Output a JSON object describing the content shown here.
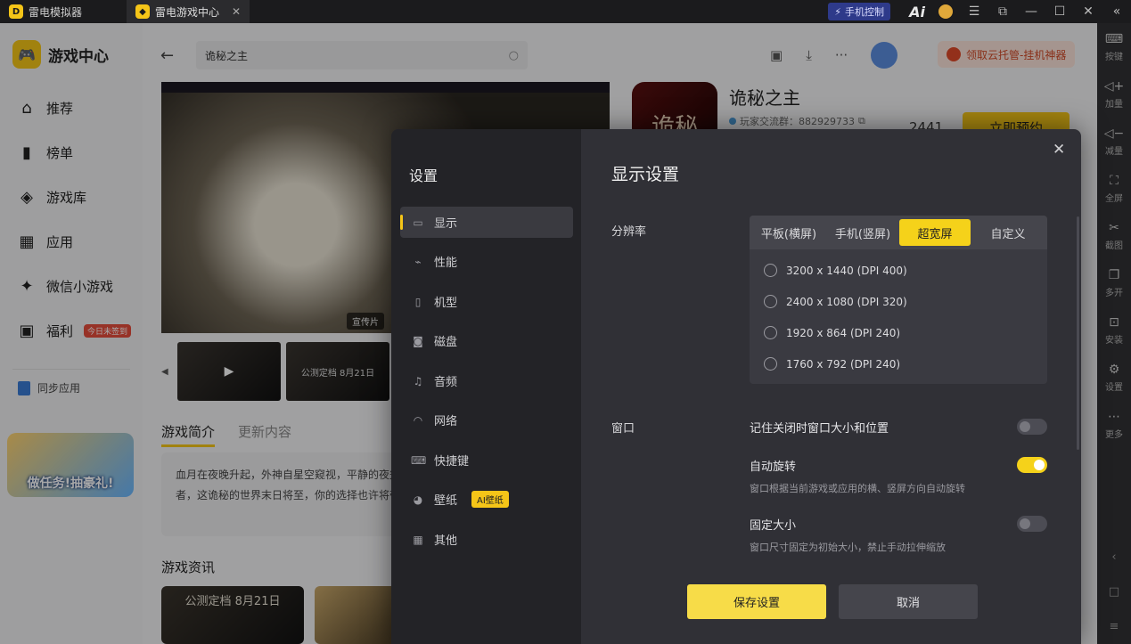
{
  "titlebar": {
    "app_tab": "雷电模拟器",
    "game_tab": "雷电游戏中心",
    "phone_control": "手机控制",
    "ai": "Ai"
  },
  "right_toolbar": {
    "items": [
      "按键",
      "加量",
      "减量",
      "全屏",
      "截图",
      "多开",
      "安装",
      "设置",
      "更多"
    ]
  },
  "app": {
    "brand": "游戏中心",
    "nav": [
      {
        "label": "推荐",
        "icon": "home-icon"
      },
      {
        "label": "榜单",
        "icon": "chart-icon"
      },
      {
        "label": "游戏库",
        "icon": "gamepad-icon"
      },
      {
        "label": "应用",
        "icon": "apps-icon"
      },
      {
        "label": "微信小游戏",
        "icon": "mini-game-icon"
      },
      {
        "label": "福利",
        "icon": "gift-icon"
      }
    ],
    "nav_badge": "今日未签到",
    "sync": "同步应用",
    "promo": "做任务!抽豪礼!",
    "search_value": "诡秘之主",
    "cloud_button": "领取云托管-挂机神器",
    "hero_tag": "宣传片",
    "thumb_1": "",
    "thumb_2": "公测定档 8月21日",
    "tab_intro": "游戏简介",
    "tab_update": "更新内容",
    "intro_text": "血月在夜晚升起，外神自星空窥视，平静的夜笼罩，神秘存在正悄悄复苏。新生的非凡者，这诡秘的世界末日将至，你的选择也许将带来",
    "news_title": "游戏资讯",
    "news_card": "公测定档 8月21日",
    "game_title": "诡秘之主",
    "game_icon_text": "诡秘",
    "game_group": "玩家交流群：882929733",
    "game_count": "2441",
    "reserve": "立即预约"
  },
  "settings": {
    "side_title": "设置",
    "side_items": [
      {
        "label": "显示",
        "icon": "monitor-icon"
      },
      {
        "label": "性能",
        "icon": "performance-icon"
      },
      {
        "label": "机型",
        "icon": "phone-icon"
      },
      {
        "label": "磁盘",
        "icon": "disk-icon"
      },
      {
        "label": "音频",
        "icon": "audio-icon"
      },
      {
        "label": "网络",
        "icon": "wifi-icon"
      },
      {
        "label": "快捷键",
        "icon": "keyboard-icon"
      },
      {
        "label": "壁纸",
        "icon": "palette-icon"
      },
      {
        "label": "其他",
        "icon": "grid-icon"
      }
    ],
    "wallpaper_badge": "AI壁纸",
    "title": "显示设置",
    "resolution_label": "分辨率",
    "segments": [
      "平板(横屏)",
      "手机(竖屏)",
      "超宽屏",
      "自定义"
    ],
    "selected_segment": "超宽屏",
    "resolutions": [
      "3200 x 1440  (DPI 400)",
      "2400 x 1080  (DPI 320)",
      "1920 x 864   (DPI 240)",
      "1760 x 792   (DPI 240)"
    ],
    "window_label": "窗口",
    "remember_window": "记住关闭时窗口大小和位置",
    "auto_rotate": "自动旋转",
    "auto_rotate_desc": "窗口根据当前游戏或应用的横、竖屏方向自动旋转",
    "fixed_size": "固定大小",
    "fixed_size_desc": "窗口尺寸固定为初始大小，禁止手动拉伸缩放",
    "toggles": {
      "remember_window": false,
      "auto_rotate": true,
      "fixed_size": false
    },
    "save": "保存设置",
    "cancel": "取消"
  },
  "colors": {
    "accent": "#f5d21a",
    "modal_bg": "#303036",
    "sidebar_bg": "#232327"
  }
}
